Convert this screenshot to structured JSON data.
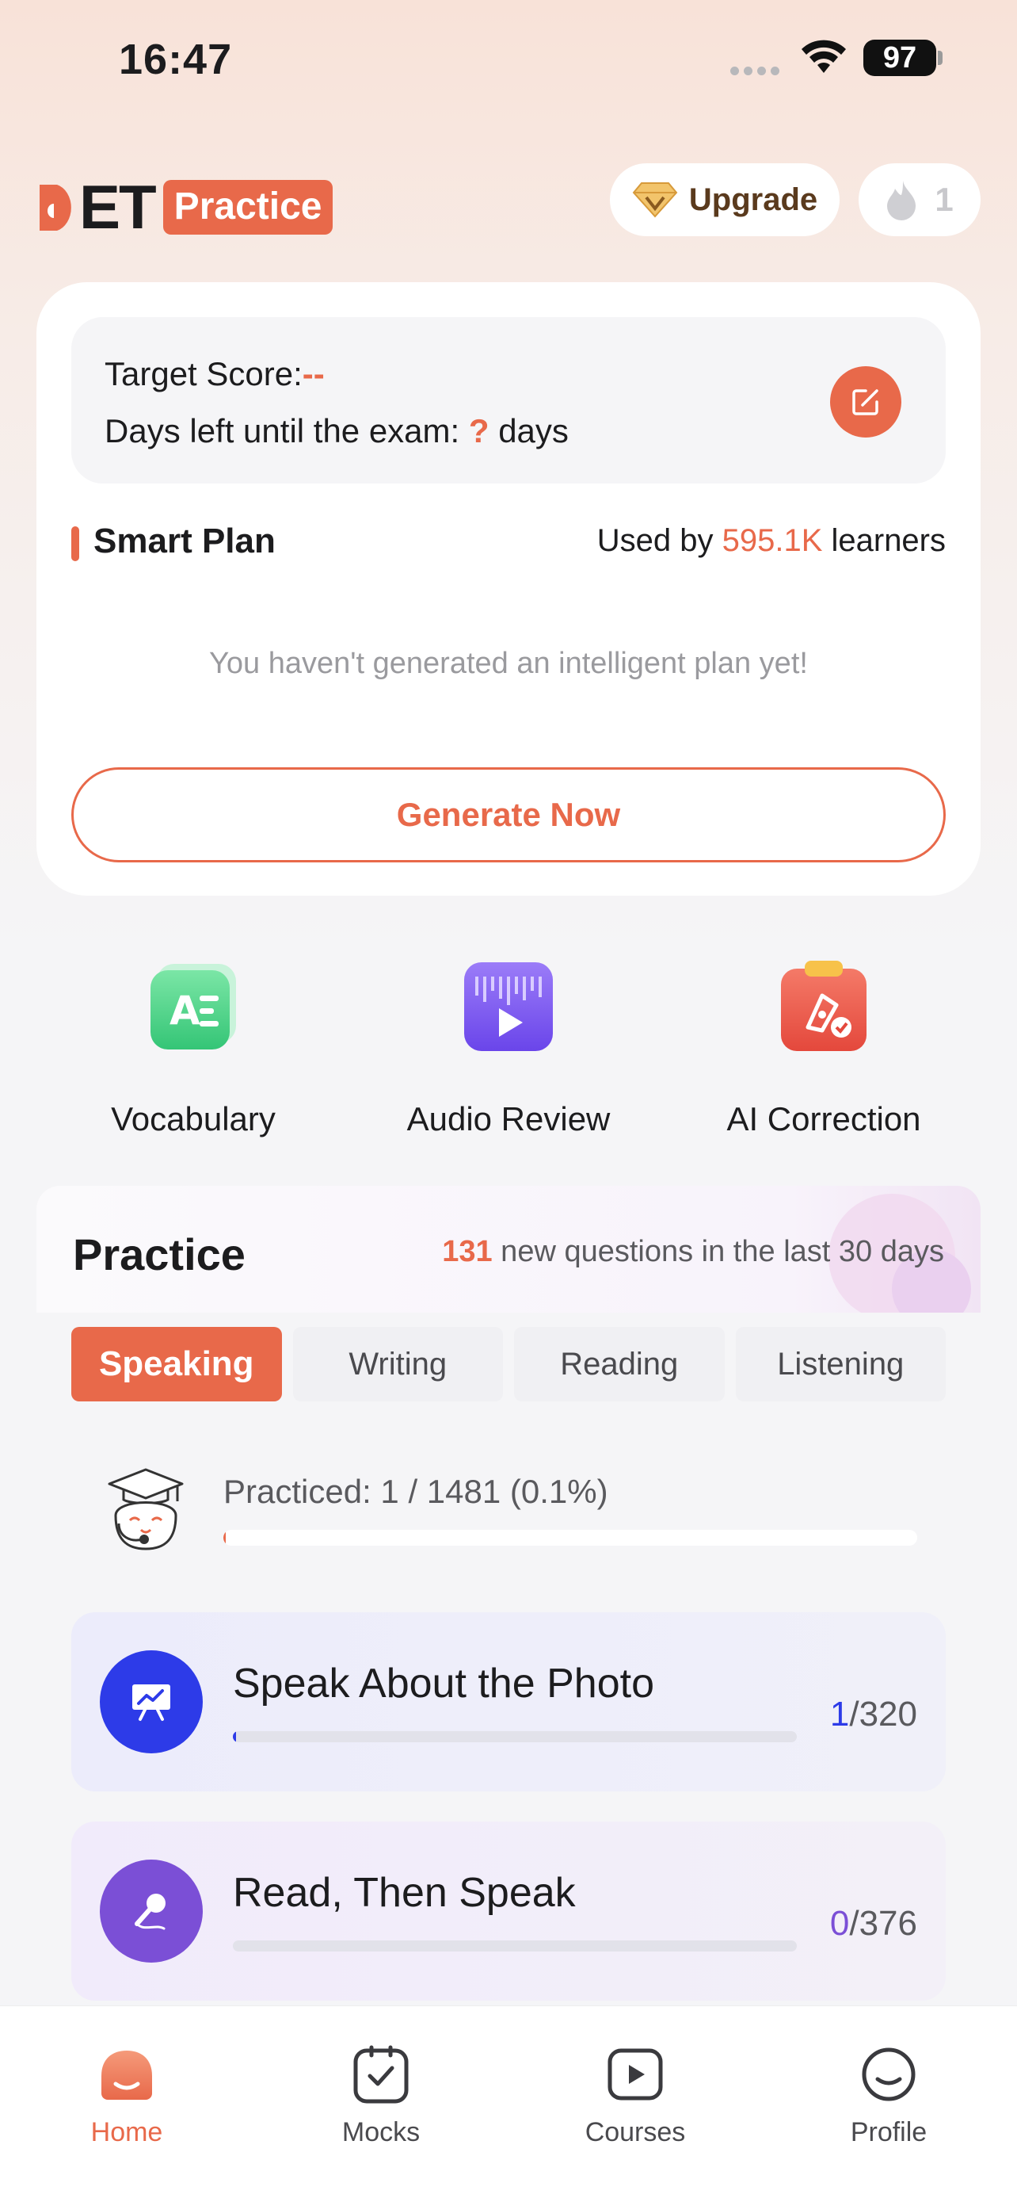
{
  "status_bar": {
    "time": "16:47",
    "battery": "97"
  },
  "header": {
    "logo_text": "DET",
    "logo_badge": "Practice",
    "upgrade_label": "Upgrade",
    "streak_count": "1"
  },
  "plan_card": {
    "target_label": "Target Score:",
    "target_value": "--",
    "days_prefix": "Days left until the exam: ",
    "days_value": "?",
    "days_suffix": " days",
    "smart_plan_title": "Smart Plan",
    "used_prefix": "Used by ",
    "used_count": "595.1K",
    "used_suffix": " learners",
    "empty_message": "You haven't generated an intelligent plan yet!",
    "generate_label": "Generate Now"
  },
  "tools": [
    {
      "label": "Vocabulary",
      "icon": "vocabulary-icon",
      "color": "#4fd184"
    },
    {
      "label": "Audio Review",
      "icon": "audio-review-icon",
      "color": "#7b5cf0"
    },
    {
      "label": "AI Correction",
      "icon": "ai-correction-icon",
      "color": "#ee5a4a"
    }
  ],
  "practice": {
    "title": "Practice",
    "new_count": "131",
    "new_middle": " new questions in the last ",
    "new_days": "30",
    "new_suffix": " days",
    "tabs": [
      "Speaking",
      "Writing",
      "Reading",
      "Listening"
    ],
    "active_tab": "Speaking",
    "progress_text": "Practiced: 1 / 1481 (0.1%)",
    "progress_fraction": 0.001,
    "tasks": [
      {
        "title": "Speak About the Photo",
        "done": "1",
        "total": "/320",
        "progress_fraction": 0.003,
        "color": "#2d3be8"
      },
      {
        "title": "Read, Then Speak",
        "done": "0",
        "total": "/376",
        "progress_fraction": 0,
        "color": "#7b4fd6"
      }
    ]
  },
  "bottom_nav": [
    {
      "label": "Home",
      "icon": "home-icon",
      "active": true
    },
    {
      "label": "Mocks",
      "icon": "mocks-icon",
      "active": false
    },
    {
      "label": "Courses",
      "icon": "courses-icon",
      "active": false
    },
    {
      "label": "Profile",
      "icon": "profile-icon",
      "active": false
    }
  ],
  "colors": {
    "accent": "#e8694a",
    "blue": "#2d3be8",
    "purple": "#7b4fd6"
  }
}
